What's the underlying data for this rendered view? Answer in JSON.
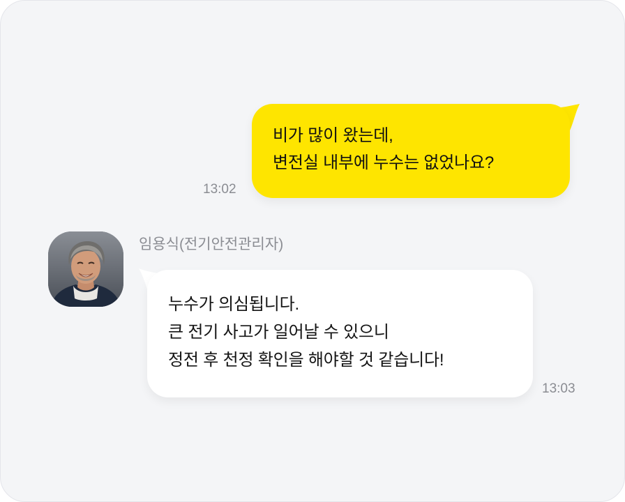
{
  "colors": {
    "background": "#f4f5f7",
    "outgoing_bubble": "#fee500",
    "incoming_bubble": "#ffffff",
    "timestamp": "#8a8c92",
    "sender_name": "#8b8d93"
  },
  "messages": {
    "outgoing": {
      "text": "비가 많이 왔는데,\n변전실 내부에 누수는 없었나요?",
      "time": "13:02"
    },
    "incoming": {
      "sender": "임용식(전기안전관리자)",
      "avatar_icon": "person-avatar-photo",
      "text": "누수가 의심됩니다.\n큰 전기 사고가 일어날 수 있으니\n정전 후 천정 확인을 해야할 것 같습니다!",
      "time": "13:03"
    }
  }
}
